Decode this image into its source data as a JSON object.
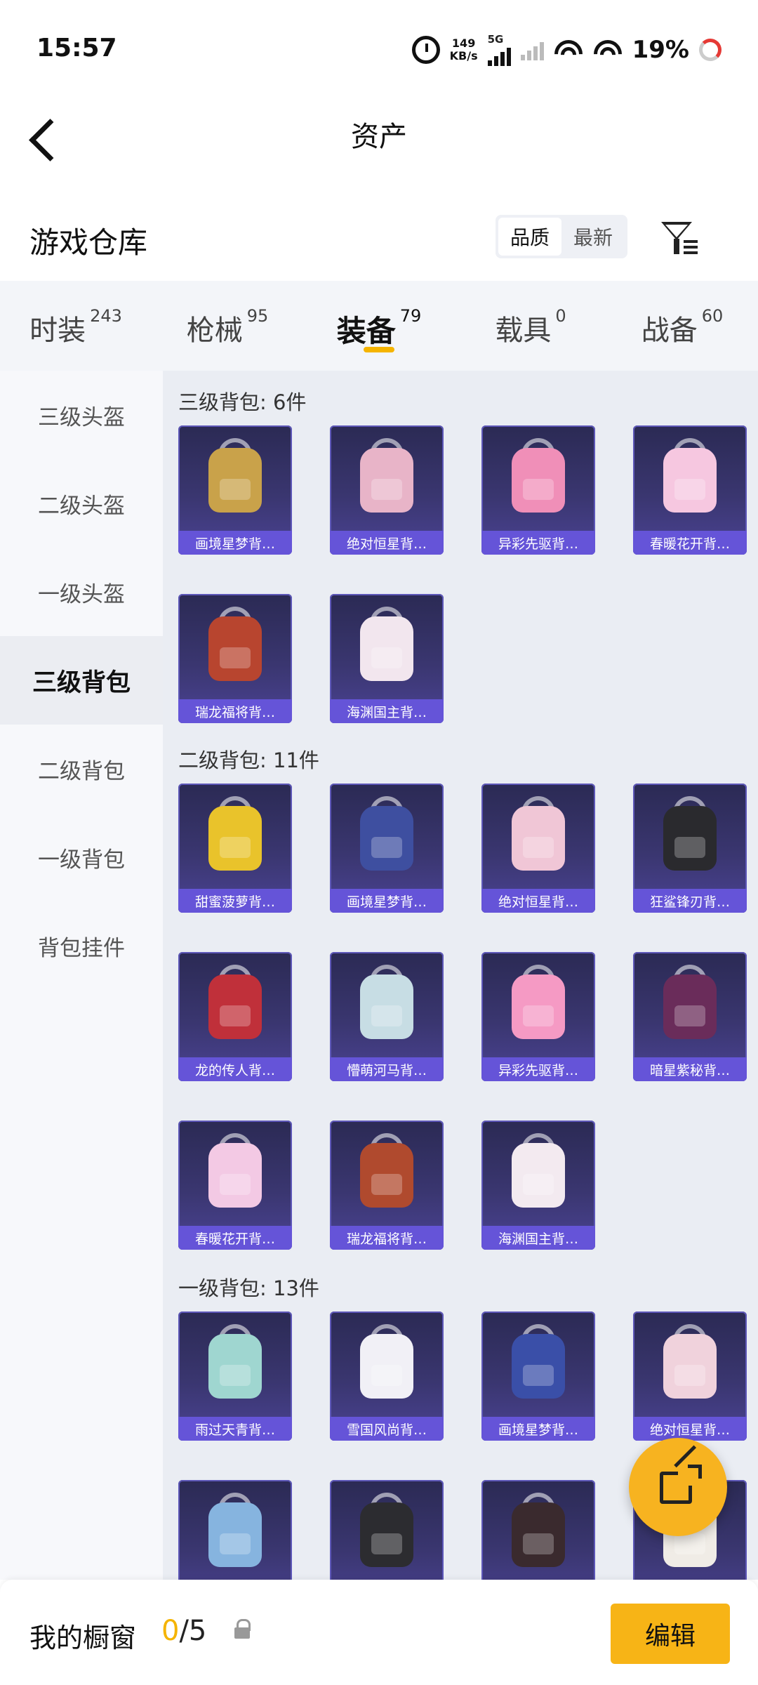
{
  "status_bar": {
    "time": "15:57",
    "net_speed_value": "149",
    "net_speed_unit": "KB/s",
    "network_type": "5G",
    "battery": "19%"
  },
  "header": {
    "title": "资产"
  },
  "section": {
    "title": "游戏仓库",
    "sort_options": [
      "品质",
      "最新"
    ],
    "sort_selected": "品质"
  },
  "tabs": [
    {
      "label": "时装",
      "count": "243"
    },
    {
      "label": "枪械",
      "count": "95"
    },
    {
      "label": "装备",
      "count": "79",
      "active": true
    },
    {
      "label": "载具",
      "count": "0"
    },
    {
      "label": "战备",
      "count": "60"
    }
  ],
  "sidebar": {
    "items": [
      "三级头盔",
      "二级头盔",
      "一级头盔",
      "三级背包",
      "二级背包",
      "一级背包",
      "背包挂件"
    ],
    "active": "三级背包"
  },
  "groups": [
    {
      "title": "三级背包: 6件",
      "items": [
        {
          "name": "画境星梦背…",
          "color": "#c9a24a"
        },
        {
          "name": "绝对恒星背…",
          "color": "#e8b4c8"
        },
        {
          "name": "异彩先驱背…",
          "color": "#f08fb8"
        },
        {
          "name": "春暖花开背…",
          "color": "#f6c7e0"
        },
        {
          "name": "瑞龙福将背…",
          "color": "#b8452f"
        },
        {
          "name": "海渊国主背…",
          "color": "#f2e6ee"
        }
      ]
    },
    {
      "title": "二级背包: 11件",
      "items": [
        {
          "name": "甜蜜菠萝背…",
          "color": "#e9c32b"
        },
        {
          "name": "画境星梦背…",
          "color": "#3e4fa0"
        },
        {
          "name": "绝对恒星背…",
          "color": "#f0c6d6"
        },
        {
          "name": "狂鲨锋刃背…",
          "color": "#2a2a2e"
        },
        {
          "name": "龙的传人背…",
          "color": "#c0303a"
        },
        {
          "name": "懵萌河马背…",
          "color": "#c7dde4"
        },
        {
          "name": "异彩先驱背…",
          "color": "#f59ac4"
        },
        {
          "name": "暗星紫秘背…",
          "color": "#6a2c5a"
        },
        {
          "name": "春暖花开背…",
          "color": "#f3c9e4"
        },
        {
          "name": "瑞龙福将背…",
          "color": "#b04a2e"
        },
        {
          "name": "海渊国主背…",
          "color": "#f3eaf0"
        }
      ]
    },
    {
      "title": "一级背包: 13件",
      "items": [
        {
          "name": "雨过天青背…",
          "color": "#9fd6d0"
        },
        {
          "name": "雪国风尚背…",
          "color": "#f1f0f6"
        },
        {
          "name": "画境星梦背…",
          "color": "#3a4fa8"
        },
        {
          "name": "绝对恒星背…",
          "color": "#f0d2dc"
        },
        {
          "name": "",
          "color": "#86b4df"
        },
        {
          "name": "",
          "color": "#2c2c30"
        },
        {
          "name": "",
          "color": "#3a2a2e"
        },
        {
          "name": "",
          "color": "#f0ece6"
        }
      ]
    }
  ],
  "bottom_bar": {
    "label": "我的橱窗",
    "current": "0",
    "max": "/5",
    "edit_label": "编辑"
  },
  "colors": {
    "accent": "#f7b416",
    "card_label": "#6554d8",
    "card_bg": "#2b2a54"
  }
}
